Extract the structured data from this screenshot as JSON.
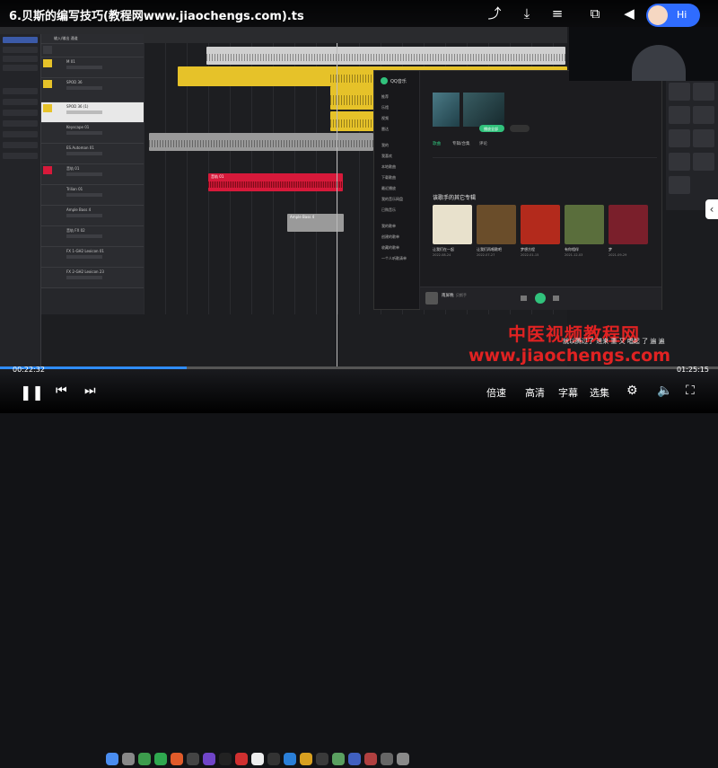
{
  "video": {
    "title": "6.贝斯的编写技巧(教程网www.jiaochengs.com).ts",
    "time_current": "00:22:32",
    "time_total": "01:25:15",
    "progress": 0.26,
    "options": [
      "倍速",
      "高清",
      "字幕",
      "选集"
    ],
    "hi_label": "Hi"
  },
  "watermark": {
    "line1": "中医视频教程网",
    "line2": "www.jiaochengs.com"
  },
  "subtitle": "就以腾过了 进来 重 又 唱起 了 遍 遍",
  "daw": {
    "tracks": [
      {
        "name": "输入/输出 通道",
        "color": "#3a3b40"
      },
      {
        "name": "",
        "color": "#3a3b40"
      },
      {
        "name": "M 01",
        "color": "#e6c229"
      },
      {
        "name": "SPOD 36",
        "color": "#e6c229"
      },
      {
        "name": "SPOD 36 (1)",
        "color": "#e8e8e8"
      },
      {
        "name": "Keyscape 01",
        "color": "#8a8a8a"
      },
      {
        "name": "ES.Automan 01",
        "color": "#8a8a8a"
      },
      {
        "name": "音轨 01",
        "color": "#d7193a"
      },
      {
        "name": "Trilian 01",
        "color": "#8a8a8a"
      },
      {
        "name": "Ample Bass 4",
        "color": "#8a8a8a"
      },
      {
        "name": "音轨 FX 02",
        "color": "#8a8a8a"
      },
      {
        "name": "FX 1-GH2 Lexicon 01",
        "color": "#8a8a8a"
      },
      {
        "name": "FX 2-GH2 Lexicon 23",
        "color": "#8a8a8a"
      }
    ],
    "clips": {
      "red": "音轨 01",
      "bass": "Ample Bass 4"
    }
  },
  "qq_music": {
    "app_name": "QQ音乐",
    "sidebar": [
      "推荐",
      "乐馆",
      "视频",
      "雷达",
      "我的",
      "我喜欢",
      "本地歌曲",
      "下载歌曲",
      "最近播放",
      "我的音乐网盘",
      "已购音乐",
      "我的歌单",
      "创建的歌单",
      "收藏的歌单",
      "一个人听歌清单"
    ],
    "tabs": [
      "歌曲",
      "专辑/合集",
      "评论"
    ],
    "play_button": "播放全部",
    "section_title": "该歌手的其它专辑",
    "albums": [
      {
        "title": "让我们在一起",
        "date": "2022-08-24",
        "color": "#e8e1cc"
      },
      {
        "title": "让我们再唱歌吧",
        "date": "2022-07-27",
        "color": "#6a4d2a"
      },
      {
        "title": "梦想方程",
        "date": "2022-01-15",
        "color": "#b32a1c"
      },
      {
        "title": "有你相伴",
        "date": "2021-12-03",
        "color": "#5a6e3c"
      },
      {
        "title": "梦",
        "date": "2021-09-29",
        "color": "#7a1f2b"
      }
    ],
    "now_playing": {
      "song": "南屏晚",
      "artist": "贝斯手"
    },
    "colors": {
      "accent": "#31c27c"
    }
  }
}
